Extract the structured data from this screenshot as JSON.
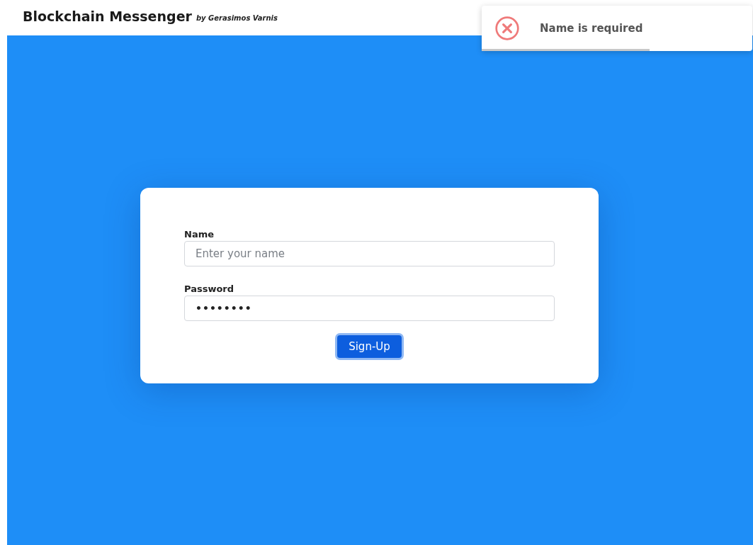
{
  "header": {
    "title": "Blockchain Messenger",
    "byline": "by Gerasimos Varnis"
  },
  "toast": {
    "kind": "error",
    "message": "Name is required",
    "level": 0.62
  },
  "form": {
    "fields": [
      {
        "label": "Name",
        "placeholder": "Enter your name"
      },
      {
        "label": "Password",
        "value": "••••••••"
      }
    ],
    "button": {
      "label": "Sign-Up",
      "focused": true
    }
  }
}
